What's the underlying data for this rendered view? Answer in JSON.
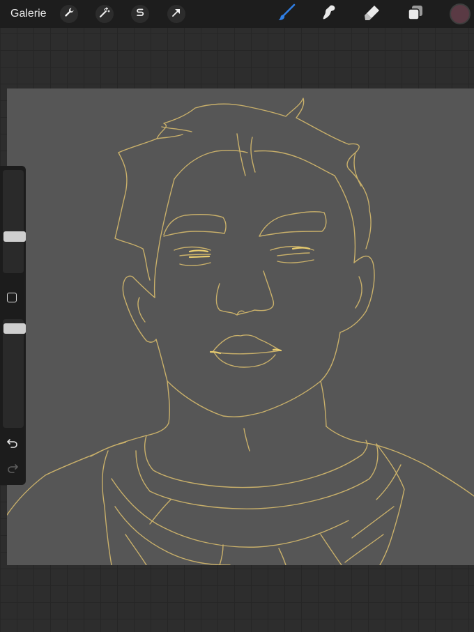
{
  "toolbar": {
    "gallery_label": "Galerie",
    "left_tools": [
      "wrench-icon",
      "magic-wand-icon",
      "selection-s-icon",
      "transform-arrow-icon"
    ],
    "right_tools": [
      "brush-icon",
      "smudge-icon",
      "eraser-icon",
      "layers-icon"
    ],
    "active_tool": "brush",
    "active_color": "#5a3a44"
  },
  "sidebar": {
    "brush_size_level": 0.58,
    "opacity_level": 0.06,
    "modify_button": "square-icon",
    "undo": "undo-icon",
    "redo": "redo-icon"
  },
  "canvas": {
    "background_color": "#565656",
    "stroke_color": "#c9b06a",
    "content": "line-art-portrait"
  }
}
